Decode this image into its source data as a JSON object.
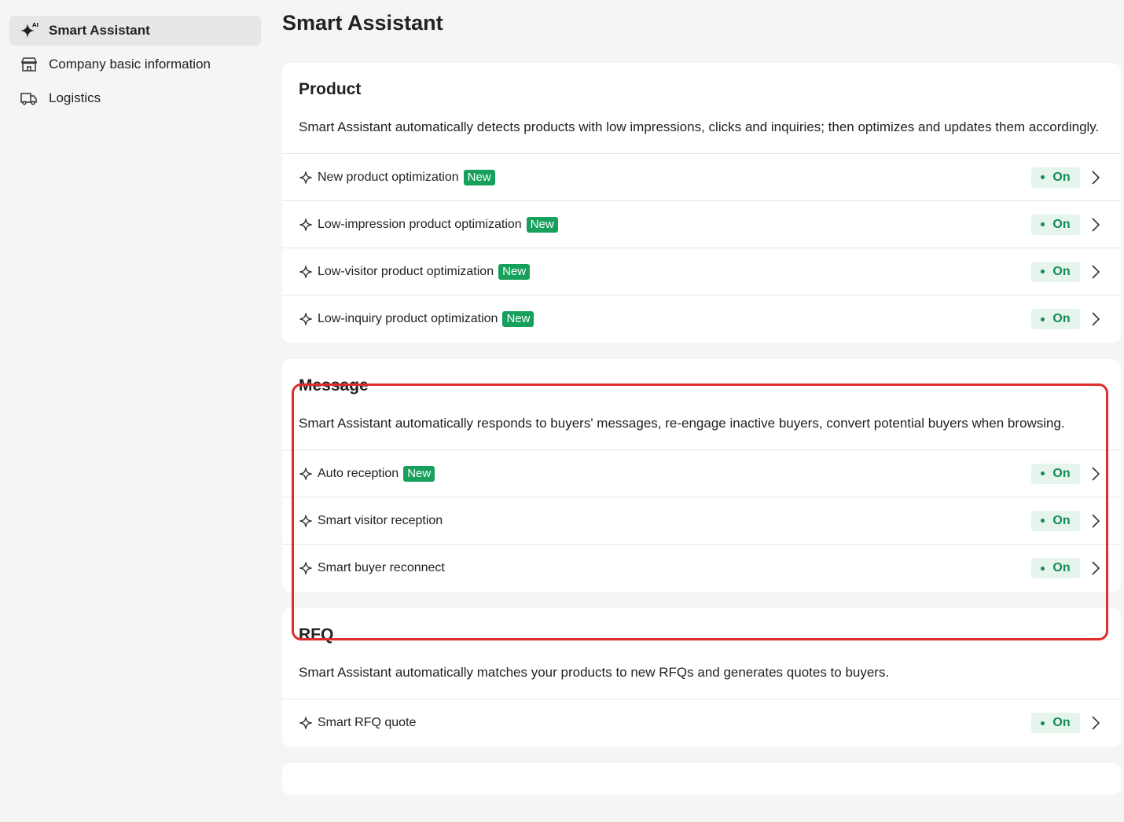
{
  "sidebar": {
    "items": [
      {
        "label": "Smart Assistant",
        "icon": "ai-sparkle-icon",
        "active": true
      },
      {
        "label": "Company basic information",
        "icon": "store-icon"
      },
      {
        "label": "Logistics",
        "icon": "truck-icon"
      }
    ]
  },
  "main": {
    "title": "Smart Assistant",
    "badge_label": "New",
    "status_label": "On",
    "sections": [
      {
        "title": "Product",
        "description": "Smart Assistant automatically detects products with low impressions, clicks and inquiries; then optimizes and updates them accordingly.",
        "rows": [
          {
            "label": "New product optimization",
            "is_new": true,
            "status": "On"
          },
          {
            "label": "Low-impression product optimization",
            "is_new": true,
            "status": "On"
          },
          {
            "label": "Low-visitor product optimization",
            "is_new": true,
            "status": "On"
          },
          {
            "label": "Low-inquiry product optimization",
            "is_new": true,
            "status": "On"
          }
        ]
      },
      {
        "title": "Message",
        "description": "Smart Assistant automatically responds to buyers' messages, re-engage inactive buyers, convert potential buyers when browsing.",
        "highlighted": true,
        "rows": [
          {
            "label": "Auto reception",
            "is_new": true,
            "status": "On"
          },
          {
            "label": "Smart visitor reception",
            "is_new": false,
            "status": "On"
          },
          {
            "label": "Smart buyer reconnect",
            "is_new": false,
            "status": "On"
          }
        ]
      },
      {
        "title": "RFQ",
        "description": "Smart Assistant automatically matches your products to new RFQs and generates quotes to buyers.",
        "rows": [
          {
            "label": "Smart RFQ quote",
            "is_new": false,
            "status": "On"
          }
        ]
      }
    ]
  },
  "colors": {
    "accent_green": "#16a05c",
    "status_bg": "#e5f5ec",
    "highlight_red": "#e22b2b"
  }
}
